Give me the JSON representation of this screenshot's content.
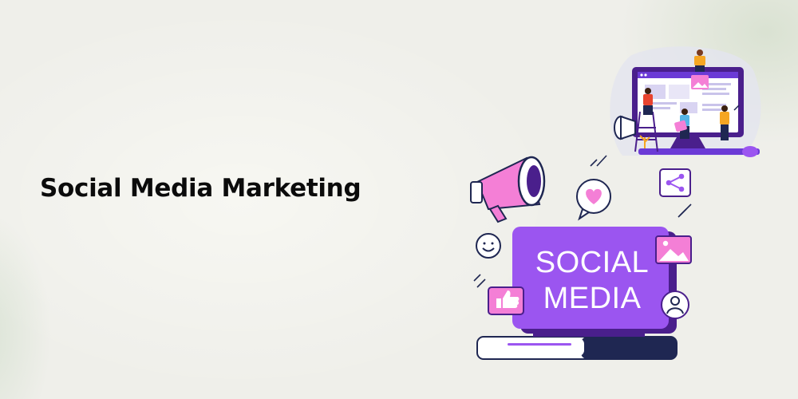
{
  "headline": "Social Media Marketing",
  "screen": {
    "line1": "SOCIAL",
    "line2": "MEDIA"
  },
  "colors": {
    "purple": "#9b55f0",
    "dark_purple": "#4a1f8c",
    "pink": "#f47fd6",
    "orange": "#f5a623",
    "navy": "#1f2752"
  },
  "icons": [
    "megaphone-icon",
    "heart-icon",
    "share-icon",
    "smiley-icon",
    "thumbs-up-icon",
    "image-icon",
    "user-icon",
    "monitor-icon"
  ]
}
